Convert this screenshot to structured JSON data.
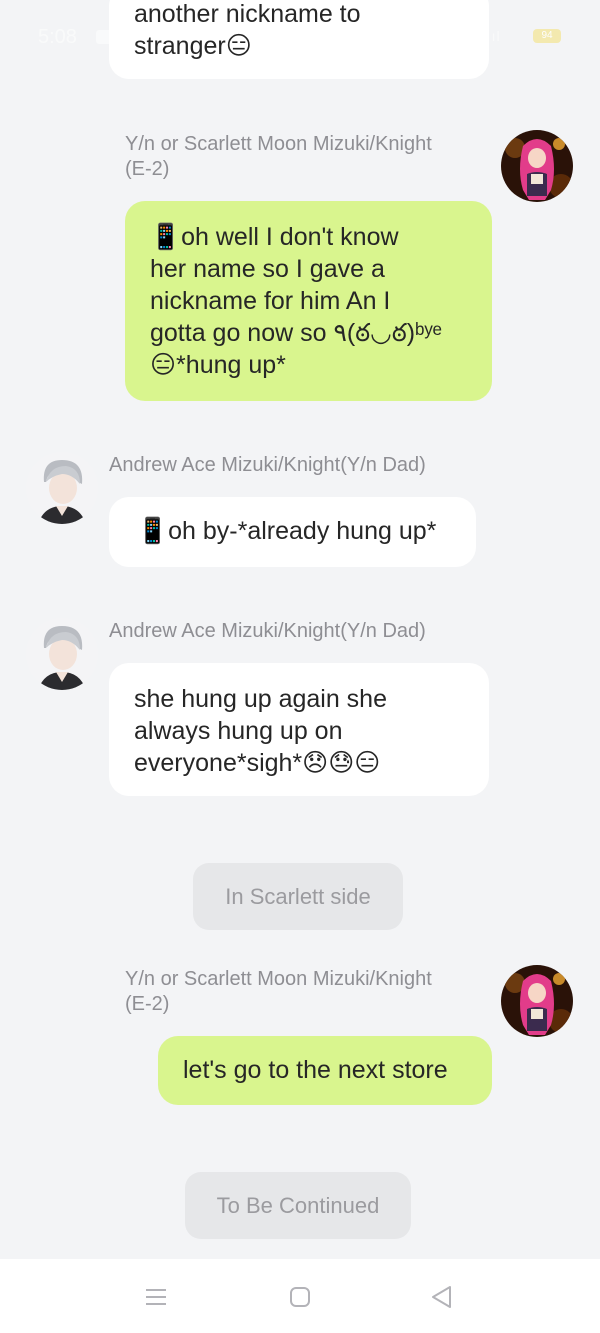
{
  "status_bar": {
    "time": "5:08",
    "battery": "94"
  },
  "messages": [
    {
      "id": "m0",
      "sender": "",
      "text": "another nickname to\nstranger😑",
      "side": "left"
    },
    {
      "id": "m1",
      "sender": "Y/n or Scarlett Moon Mizuki/Knight\n(E-2)",
      "text": "📱oh well I don't know\nher name so I gave a\nnickname for him An I\ngotta go now so ٩(ఠ◡ఠ)ᵇʸᵉ\n😑*hung up*",
      "side": "right"
    },
    {
      "id": "m2",
      "sender": "Andrew Ace Mizuki/Knight(Y/n Dad)",
      "text": "📱oh by-*already hung up*",
      "side": "left"
    },
    {
      "id": "m3",
      "sender": "Andrew Ace Mizuki/Knight(Y/n Dad)",
      "text": "she hung up again she\nalways hung up on\neveryone*sigh*😞😓😑",
      "side": "left"
    },
    {
      "id": "m4",
      "sender": "Y/n or Scarlett Moon Mizuki/Knight\n(E-2)",
      "text": "let's go to the next store",
      "side": "right"
    }
  ],
  "narration": {
    "scene": "In Scarlett side",
    "end": "To Be Continued"
  },
  "nav": {
    "menu_icon": "menu-icon",
    "home_icon": "home-square-icon",
    "back_icon": "back-triangle-icon"
  }
}
